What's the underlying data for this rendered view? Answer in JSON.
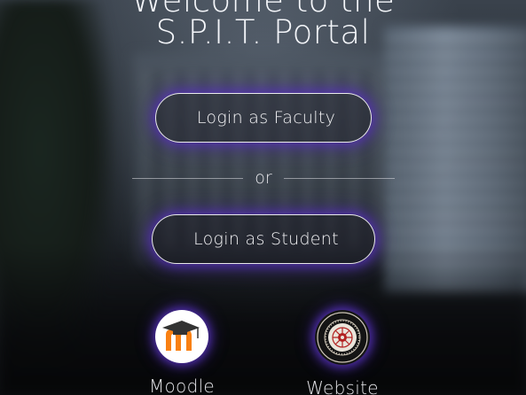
{
  "welcome": {
    "line1": "Welcome to the",
    "line2": "S.P.I.T. Portal"
  },
  "actions": {
    "faculty_label": "Login as Faculty",
    "divider_text": "or",
    "student_label": "Login as Student"
  },
  "links": [
    {
      "label": "Moodle",
      "icon": "moodle-logo-icon"
    },
    {
      "label": "Website",
      "icon": "spit-emblem-icon"
    }
  ],
  "colors": {
    "glow": "#5832be",
    "text": "#ffffff",
    "moodle_orange": "#f98012",
    "moodle_hat": "#333333",
    "emblem_red": "#b22222"
  }
}
